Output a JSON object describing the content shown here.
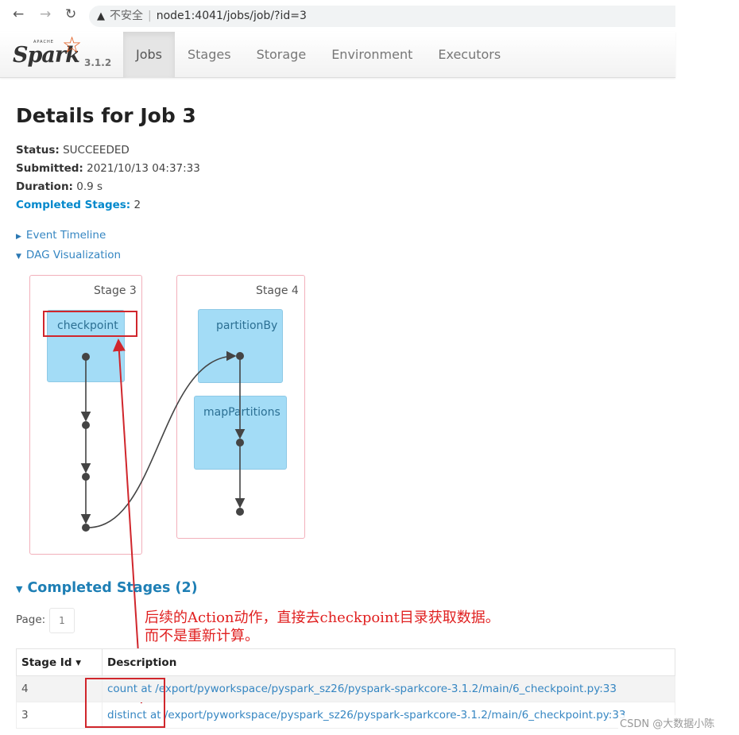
{
  "browser": {
    "back_icon": "←",
    "forward_icon": "→",
    "reload_icon": "↻",
    "warning_icon": "▲",
    "insecure_label": "不安全",
    "url": "node1:4041/jobs/job/?id=3"
  },
  "navbar": {
    "logo_text": "Spark",
    "logo_apache": "APACHE",
    "version": "3.1.2",
    "tabs": [
      {
        "label": "Jobs",
        "active": true
      },
      {
        "label": "Stages",
        "active": false
      },
      {
        "label": "Storage",
        "active": false
      },
      {
        "label": "Environment",
        "active": false
      },
      {
        "label": "Executors",
        "active": false
      }
    ]
  },
  "job": {
    "title": "Details for Job 3",
    "status_label": "Status:",
    "status_value": "SUCCEEDED",
    "submitted_label": "Submitted:",
    "submitted_value": "2021/10/13 04:37:33",
    "duration_label": "Duration:",
    "duration_value": "0.9 s",
    "completed_stages_label": "Completed Stages:",
    "completed_stages_value": "2"
  },
  "toggles": {
    "event_timeline": "Event Timeline",
    "dag_visualization": "DAG Visualization"
  },
  "dag": {
    "stages": [
      {
        "label": "Stage 3",
        "rdds": [
          "checkpoint"
        ]
      },
      {
        "label": "Stage 4",
        "rdds": [
          "partitionBy",
          "mapPartitions"
        ]
      }
    ]
  },
  "completed_stages": {
    "title": "Completed Stages (2)",
    "page_label": "Page:",
    "page_value": "1",
    "columns": [
      "Stage Id ▾",
      "Description"
    ],
    "rows": [
      {
        "id": "4",
        "desc_op": "count at",
        "desc_path": "/export/pyworkspace/pyspark_sz26/pyspark-sparkcore-3.1.2/main/6_checkpoint.py:33"
      },
      {
        "id": "3",
        "desc_op": "distinct at",
        "desc_path": "/export/pyworkspace/pyspark_sz26/pyspark-sparkcore-3.1.2/main/6_checkpoint.py:33"
      }
    ]
  },
  "annotation": {
    "line1": "后续的Action动作，直接去checkpoint目录获取数据。",
    "line2": "而不是重新计算。",
    "color": "#e02020"
  },
  "watermark": "CSDN @大数据小陈"
}
